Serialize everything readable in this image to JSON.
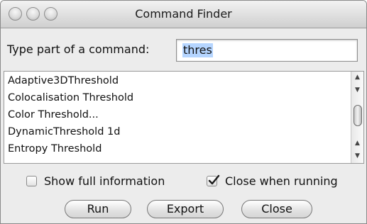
{
  "window": {
    "title": "Command Finder"
  },
  "search": {
    "label": "Type part of a command:",
    "value": "thres"
  },
  "results": {
    "items": [
      "Adaptive3DThreshold",
      "Colocalisation Threshold",
      "Color Threshold...",
      "DynamicThreshold 1d",
      "Entropy Threshold"
    ]
  },
  "options": {
    "show_full_information": {
      "label": "Show full information",
      "checked": false
    },
    "close_when_running": {
      "label": "Close when running",
      "checked": true
    }
  },
  "buttons": {
    "run": "Run",
    "export": "Export",
    "close": "Close"
  },
  "icons": {
    "close": "window-close-icon",
    "minimize": "window-minimize-icon",
    "zoom": "window-zoom-icon",
    "checkmark": "checkmark-icon"
  }
}
